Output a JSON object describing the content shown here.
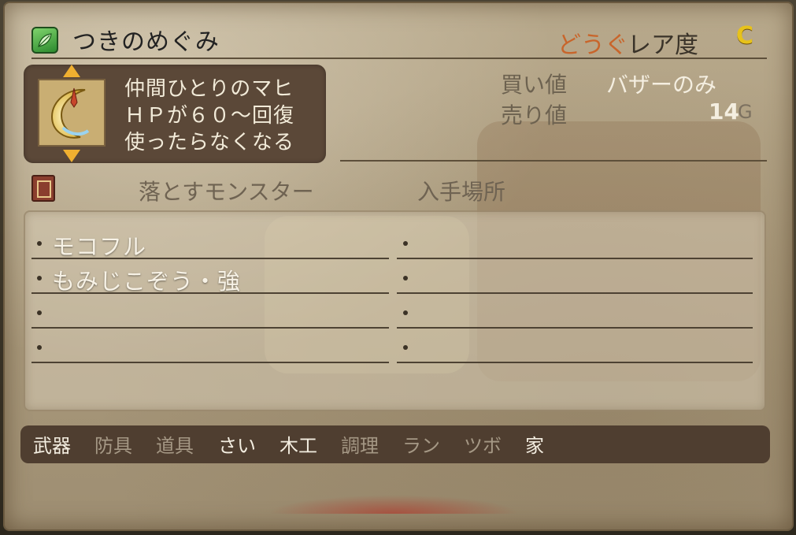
{
  "item": {
    "name": "つきのめぐみ",
    "type": "どうぐ",
    "rarity_label": "レア度",
    "rarity": "C",
    "icon": "green-leaf-icon",
    "image": "crescent-moon-item"
  },
  "description": [
    "仲間ひとりのマヒ",
    "ＨＰが６０～回復",
    "使ったらなくなる"
  ],
  "prices": {
    "buy_label": "買い値",
    "buy_value": "バザーのみ",
    "sell_label": "売り値",
    "sell_value": "14",
    "sell_unit": "G"
  },
  "sources": {
    "monster_header": "落とすモンスター",
    "location_header": "入手場所",
    "monsters": [
      "モコフル",
      "もみじこぞう・強",
      "",
      ""
    ],
    "locations": [
      "",
      "",
      "",
      ""
    ]
  },
  "tabs": [
    {
      "label": "武器",
      "active": true
    },
    {
      "label": "防具",
      "active": false
    },
    {
      "label": "道具",
      "active": false
    },
    {
      "label": "さい",
      "active": true
    },
    {
      "label": "木工",
      "active": true
    },
    {
      "label": "調理",
      "active": false
    },
    {
      "label": "ラン",
      "active": false
    },
    {
      "label": "ツボ",
      "active": false
    },
    {
      "label": "家",
      "active": true
    }
  ],
  "colors": {
    "type_accent": "#c8652b",
    "rarity": "#e7c21a",
    "panel_dark": "#5b4838"
  }
}
